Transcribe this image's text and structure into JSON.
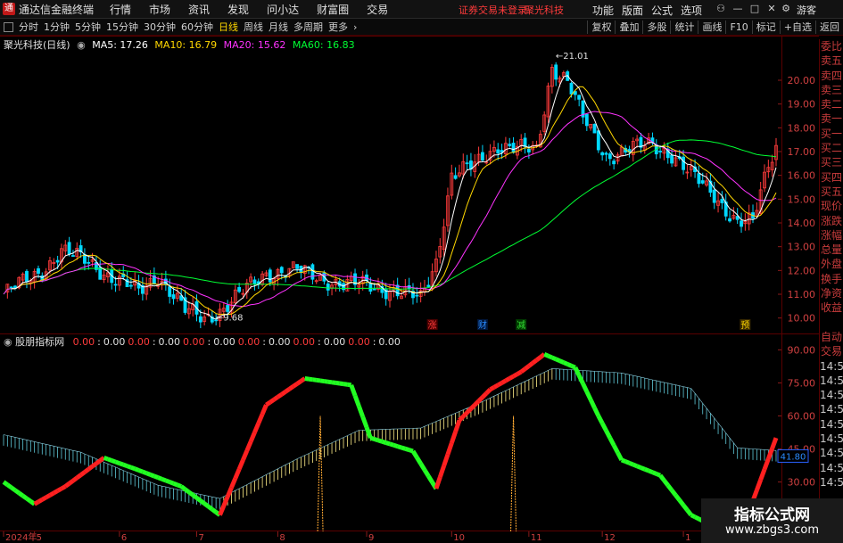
{
  "app": {
    "title": "通达信金融终端",
    "menu": [
      "行情",
      "市场",
      "资讯",
      "发现",
      "问小达",
      "财富圈",
      "交易"
    ],
    "login_notice": "证券交易未登录",
    "login_stock": "聚光科技",
    "right_menu": [
      "功能",
      "版面",
      "公式",
      "选项"
    ],
    "guest": "游客"
  },
  "toolbar": {
    "periods": [
      "分时",
      "1分钟",
      "5分钟",
      "15分钟",
      "30分钟",
      "60分钟",
      "日线",
      "周线",
      "月线",
      "多周期",
      "更多"
    ],
    "active_period": "日线",
    "right_tools": [
      "复权",
      "叠加",
      "多股",
      "统计",
      "画线",
      "F10",
      "标记",
      "+自选",
      "返回"
    ]
  },
  "main_chart": {
    "name": "聚光科技(日线)",
    "ma": [
      {
        "label": "MA5: 17.26",
        "color": "#ffffff"
      },
      {
        "label": "MA10: 16.79",
        "color": "#ffd700"
      },
      {
        "label": "MA20: 15.62",
        "color": "#ff33ff"
      },
      {
        "label": "MA60: 16.83",
        "color": "#00ff33"
      }
    ],
    "price_ticks": [
      "20.00",
      "19.00",
      "18.00",
      "17.00",
      "16.00",
      "15.00",
      "14.00",
      "13.00",
      "12.00",
      "11.00",
      "10.00"
    ],
    "high_label": "21.01",
    "low_label": "9.68",
    "markers": [
      {
        "text": "涨",
        "color": "#ff3b3b",
        "bg": "#4a0000"
      },
      {
        "text": "财",
        "color": "#2a8cff",
        "bg": "#00163a"
      },
      {
        "text": "减",
        "color": "#33dd33",
        "bg": "#003a00"
      },
      {
        "text": "预",
        "color": "#ffd700",
        "bg": "#3a2a00"
      }
    ]
  },
  "sub_chart": {
    "name": "股朋指标网",
    "values": [
      "0.00",
      "0.00",
      "0.00",
      "0.00",
      "0.00",
      "0.00",
      "0.00",
      "0.00",
      "0.00",
      "0.00",
      "0.00",
      "0.00"
    ],
    "ticks": [
      "90.00",
      "75.00",
      "60.00",
      "45.00",
      "30.00",
      "15.00"
    ],
    "current_value": "41.80"
  },
  "date_axis": [
    "2024年",
    "5",
    "6",
    "7",
    "8",
    "9",
    "10",
    "11",
    "12",
    "1"
  ],
  "sidebar": {
    "items": [
      "委比",
      "卖五",
      "卖四",
      "卖三",
      "卖二",
      "卖一",
      "买一",
      "买二",
      "买三",
      "买四",
      "买五",
      "现价",
      "涨跌",
      "涨幅",
      "总量",
      "外盘",
      "换手",
      "净资",
      "收益",
      "",
      "自动",
      "交易",
      "14:56",
      "14:56",
      "14:56",
      "14:56",
      "14:56",
      "14:56",
      "14:56",
      "14:56",
      "14:56"
    ]
  },
  "watermark": {
    "title": "指标公式网",
    "url": "www.zbgs3.com"
  },
  "chart_data": {
    "type": "candlestick",
    "y_range": [
      9.5,
      21.5
    ],
    "n_bars": 200,
    "close_keypoints": [
      [
        0,
        11.0
      ],
      [
        10,
        12.0
      ],
      [
        15,
        12.8
      ],
      [
        22,
        12.4
      ],
      [
        28,
        11.7
      ],
      [
        35,
        11.1
      ],
      [
        40,
        11.8
      ],
      [
        47,
        10.3
      ],
      [
        52,
        10.0
      ],
      [
        57,
        10.4
      ],
      [
        62,
        11.1
      ],
      [
        68,
        11.9
      ],
      [
        76,
        12.0
      ],
      [
        82,
        11.7
      ],
      [
        88,
        11.4
      ],
      [
        94,
        11.4
      ],
      [
        100,
        11.2
      ],
      [
        104,
        11.0
      ],
      [
        108,
        10.8
      ],
      [
        112,
        12.4
      ],
      [
        116,
        16.0
      ],
      [
        122,
        16.4
      ],
      [
        128,
        17.3
      ],
      [
        134,
        17.1
      ],
      [
        138,
        17.0
      ],
      [
        142,
        20.6
      ],
      [
        146,
        20.0
      ],
      [
        150,
        18.4
      ],
      [
        156,
        16.8
      ],
      [
        162,
        17.1
      ],
      [
        168,
        17.3
      ],
      [
        173,
        16.9
      ],
      [
        178,
        16.0
      ],
      [
        184,
        15.2
      ],
      [
        190,
        14.0
      ],
      [
        194,
        14.0
      ],
      [
        198,
        16.5
      ],
      [
        200,
        17.26
      ]
    ],
    "ma_current": {
      "MA5": 17.26,
      "MA10": 16.79,
      "MA20": 15.62,
      "MA60": 16.83
    },
    "sub_indicator": {
      "y_range": [
        10,
        95
      ],
      "main_line_keypoints": [
        [
          0,
          30
        ],
        [
          8,
          20
        ],
        [
          16,
          28
        ],
        [
          26,
          41
        ],
        [
          34,
          36
        ],
        [
          46,
          28
        ],
        [
          56,
          15
        ],
        [
          68,
          65
        ],
        [
          78,
          77
        ],
        [
          90,
          74
        ],
        [
          95,
          50
        ],
        [
          106,
          44
        ],
        [
          112,
          27
        ],
        [
          118,
          58
        ],
        [
          126,
          72
        ],
        [
          134,
          80
        ],
        [
          140,
          88
        ],
        [
          148,
          82
        ],
        [
          154,
          60
        ],
        [
          160,
          40
        ],
        [
          170,
          33
        ],
        [
          178,
          15
        ],
        [
          186,
          8
        ],
        [
          192,
          12
        ],
        [
          200,
          50
        ]
      ],
      "slow_line_keypoints": [
        [
          0,
          49
        ],
        [
          20,
          41
        ],
        [
          40,
          26
        ],
        [
          56,
          20
        ],
        [
          76,
          38
        ],
        [
          92,
          51
        ],
        [
          108,
          52
        ],
        [
          124,
          64
        ],
        [
          142,
          79
        ],
        [
          160,
          77
        ],
        [
          178,
          70
        ],
        [
          190,
          43
        ],
        [
          200,
          41.8
        ]
      ]
    }
  }
}
